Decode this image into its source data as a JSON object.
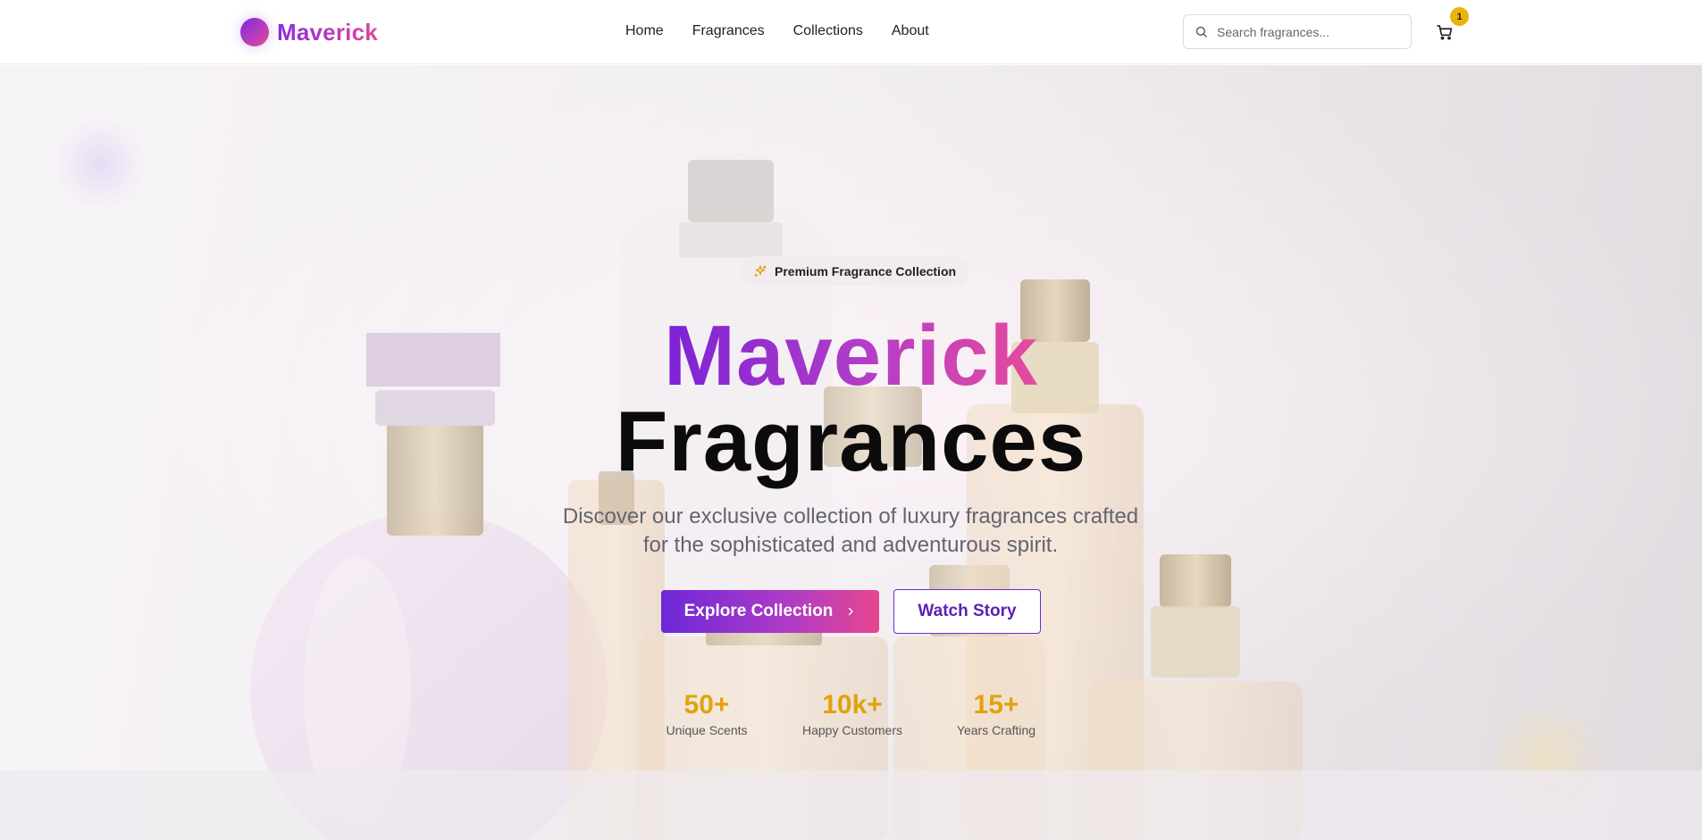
{
  "brand": {
    "name": "Maverick"
  },
  "nav": {
    "links": [
      {
        "label": "Home"
      },
      {
        "label": "Fragrances"
      },
      {
        "label": "Collections"
      },
      {
        "label": "About"
      }
    ]
  },
  "search": {
    "placeholder": "Search fragrances...",
    "value": ""
  },
  "cart": {
    "count": "1",
    "icon": "cart-icon"
  },
  "hero": {
    "badge": "Premium Fragrance Collection",
    "badge_icon": "sparkles-icon",
    "title_line1": "Maverick",
    "title_line2": "Fragrances",
    "subtitle": "Discover our exclusive collection of luxury fragrances crafted for the sophisticated and adventurous spirit.",
    "primary_button": "Explore Collection",
    "secondary_button": "Watch Story",
    "stats": [
      {
        "value": "50+",
        "label": "Unique Scents"
      },
      {
        "value": "10k+",
        "label": "Happy Customers"
      },
      {
        "value": "15+",
        "label": "Years Crafting"
      }
    ]
  },
  "colors": {
    "accent_purple": "#6d28d9",
    "accent_pink": "#e6468f",
    "stat_gold": "#e0a30a",
    "badge_yellow": "#eab308"
  }
}
